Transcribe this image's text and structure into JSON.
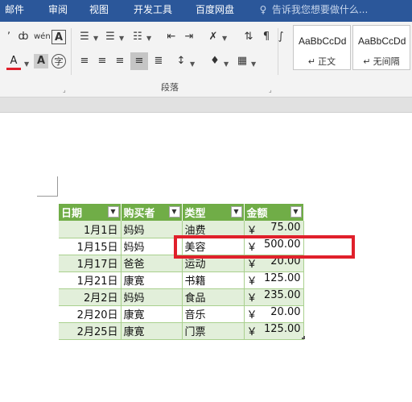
{
  "tabs": [
    "邮件",
    "审阅",
    "视图",
    "开发工具",
    "百度网盘"
  ],
  "tell_me": "告诉我您想要做什么...",
  "ribbon": {
    "group_label": "段落",
    "styles": [
      {
        "sample": "AaBbCcDd",
        "name": "↵ 正文"
      },
      {
        "sample": "AaBbCcDd",
        "name": "↵ 无间隔"
      }
    ],
    "font_color": "#e0202b"
  },
  "table": {
    "headers": [
      "日期",
      "购买者",
      "类型",
      "金额"
    ],
    "currency": "￥",
    "rows": [
      {
        "date": "1月1日",
        "buyer": "妈妈",
        "type": "油费",
        "amount": "75.00"
      },
      {
        "date": "1月15日",
        "buyer": "妈妈",
        "type": "美容",
        "amount": "500.00"
      },
      {
        "date": "1月17日",
        "buyer": "爸爸",
        "type": "运动",
        "amount": "20.00"
      },
      {
        "date": "1月21日",
        "buyer": "康寛",
        "type": "书籍",
        "amount": "125.00"
      },
      {
        "date": "2月2日",
        "buyer": "妈妈",
        "type": "食品",
        "amount": "235.00"
      },
      {
        "date": "2月20日",
        "buyer": "康寛",
        "type": "音乐",
        "amount": "20.00"
      },
      {
        "date": "2月25日",
        "buyer": "康寛",
        "type": "门票",
        "amount": "125.00"
      }
    ]
  },
  "colors": {
    "header": "#70ad47",
    "band": "#e2efda",
    "highlight": "#e0202b",
    "tabbar": "#2b579a"
  }
}
